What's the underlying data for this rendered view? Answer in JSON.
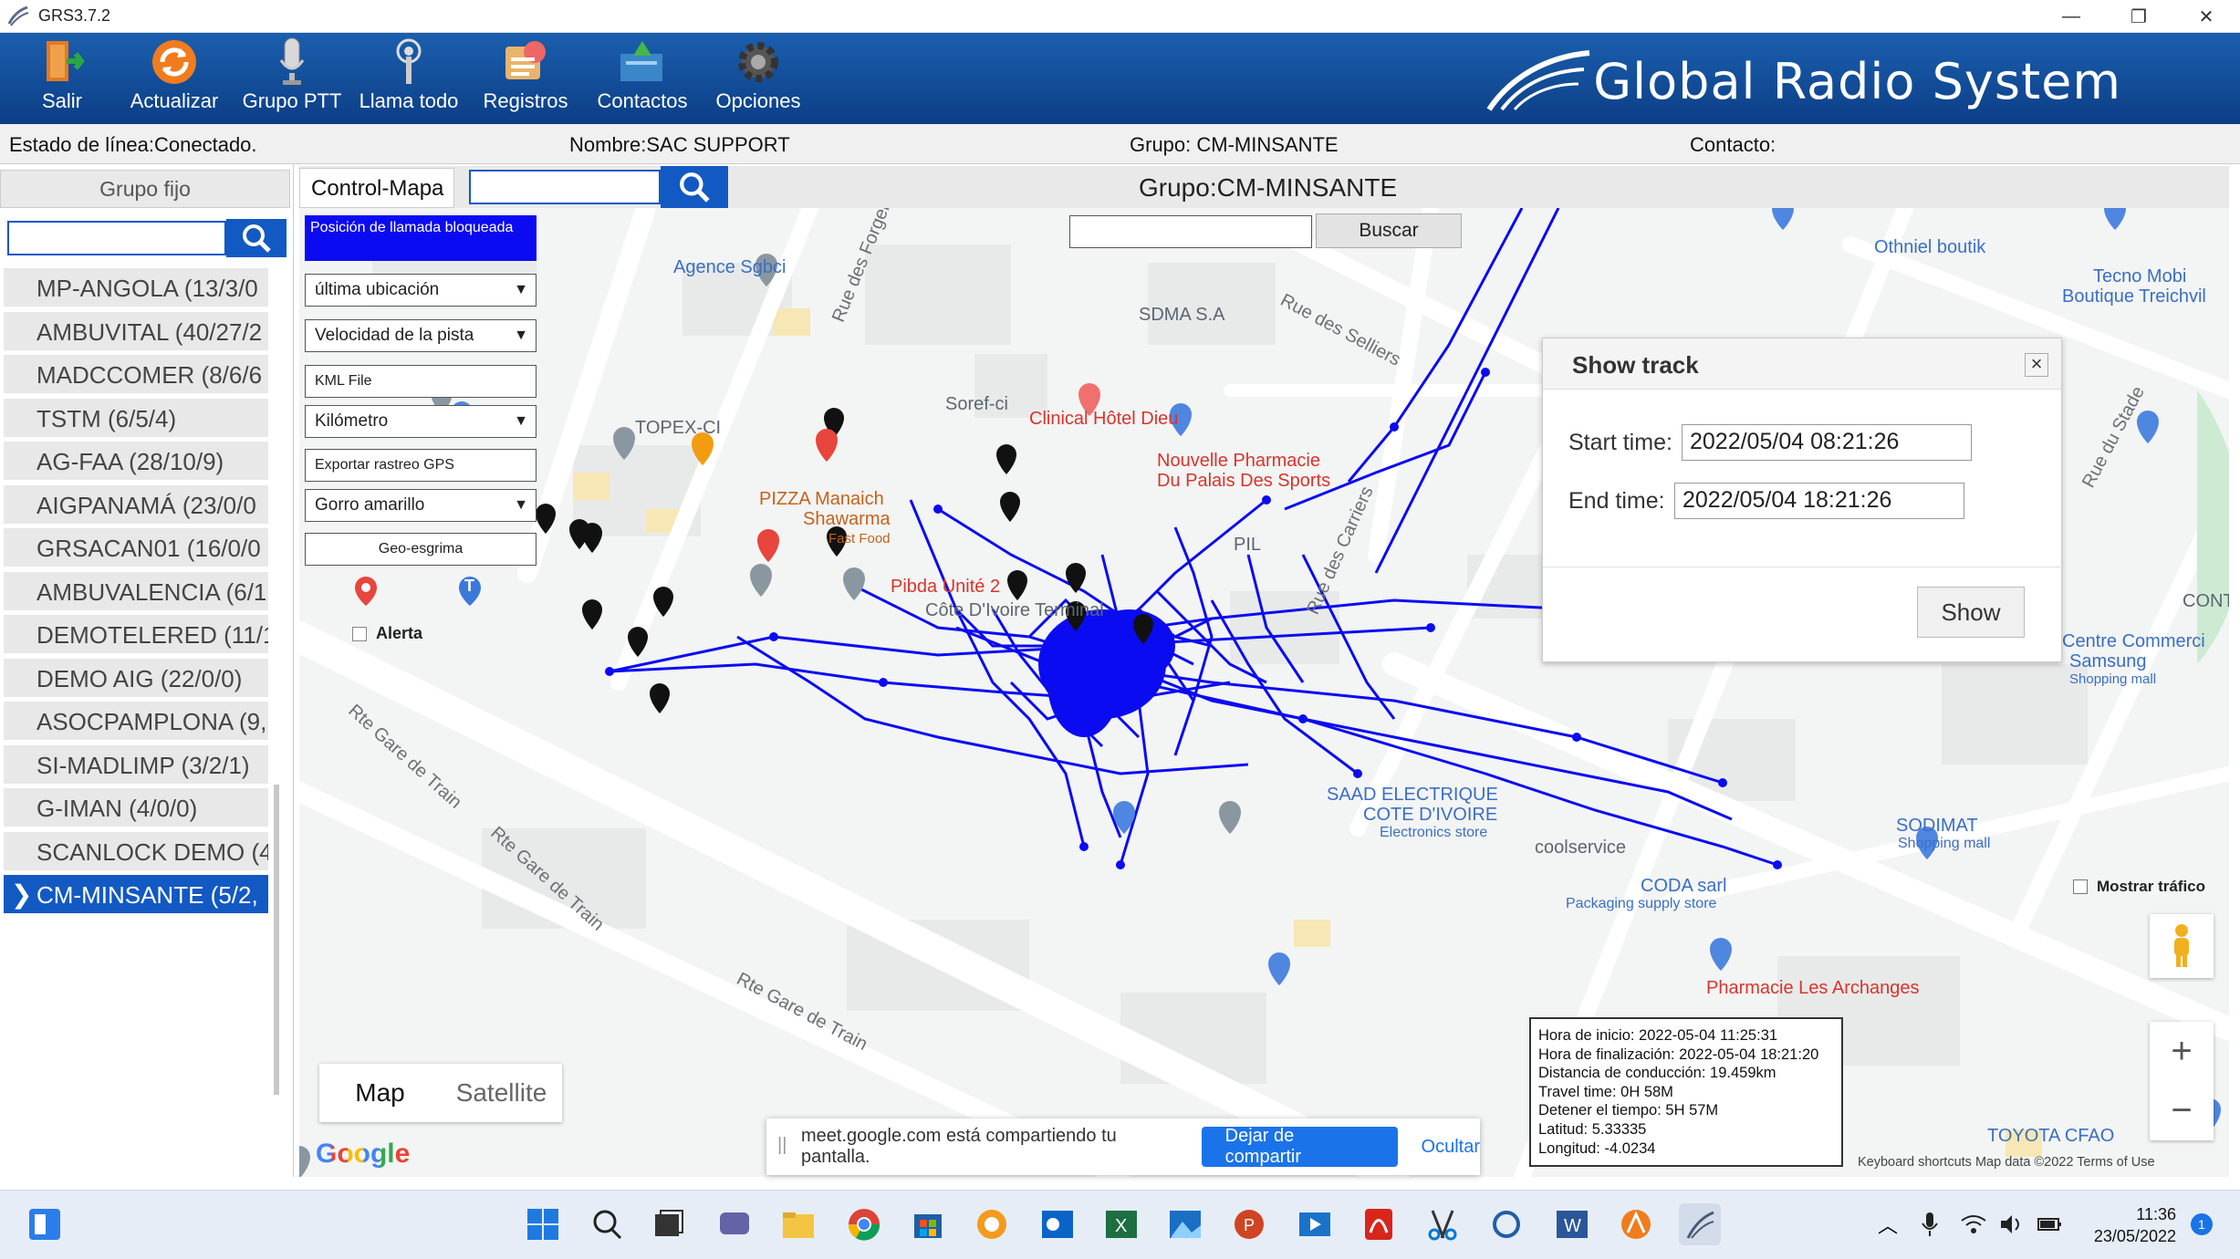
{
  "window": {
    "title": "GRS3.7.2"
  },
  "toolbar": {
    "items": [
      {
        "label": "Salir"
      },
      {
        "label": "Actualizar"
      },
      {
        "label": "Grupo PTT"
      },
      {
        "label": "Llama todo"
      },
      {
        "label": "Registros"
      },
      {
        "label": "Contactos"
      },
      {
        "label": "Opciones"
      }
    ],
    "brand": "Global Radio System"
  },
  "status": {
    "linea": "Estado de línea:Conectado.",
    "nombre": "Nombre:SAC SUPPORT",
    "grupo": "Grupo: CM-MINSANTE",
    "contacto": "Contacto:"
  },
  "left": {
    "header": "Grupo fijo",
    "groups": [
      "MP-ANGOLA (13/3/0",
      "AMBUVITAL (40/27/2",
      "MADCCOMER (8/6/6",
      "TSTM (6/5/4)",
      "AG-FAA (28/10/9)",
      "AIGPANAMÁ (23/0/0",
      "GRSACAN01 (16/0/0",
      "AMBUVALENCIA (6/1",
      "DEMOTELERED (11/1",
      "DEMO AIG (22/0/0)",
      "ASOCPAMPLONA (9,",
      "SI-MADLIMP (3/2/1)",
      "G-IMAN (4/0/0)",
      "SCANLOCK DEMO (4",
      "CM-MINSANTE (5/2,"
    ]
  },
  "mapheader": {
    "tab": "Control-Mapa",
    "title": "Grupo:CM-MINSANTE"
  },
  "control": {
    "posicion": "Posición de llamada bloqueada",
    "ultima": "última ubicación",
    "velocidad": "Velocidad de la pista",
    "kml": "KML File",
    "km": "Kilómetro",
    "exportar": "Exportar rastreo GPS",
    "gorro": "Gorro amarillo",
    "geo": "Geo-esgrima",
    "alerta": "Alerta",
    "t_marker": "T"
  },
  "search": {
    "buscar": "Buscar"
  },
  "showtrack": {
    "title": "Show track",
    "close": "×",
    "start_label": "Start time:",
    "start_value": "2022/05/04 08:21:26",
    "end_label": "End time:",
    "end_value": "2022/05/04 18:21:26",
    "button": "Show"
  },
  "info": {
    "lines": [
      "Hora de inicio: 2022-05-04 11:25:31",
      "Hora de finalización: 2022-05-04 18:21:20",
      "Distancia de conducción: 19.459km",
      "Travel time: 0H 58M",
      "Detener el tiempo: 5H 57M",
      "Latitud: 5.33335",
      "Longitud: -4.0234"
    ]
  },
  "map": {
    "pois": [
      {
        "t": "Agence Sgbci",
        "c": "blue"
      },
      {
        "t": "SDMA S.A",
        "c": "gray"
      },
      {
        "t": "TOPEX-CI",
        "c": "gray"
      },
      {
        "t": "Soref-ci",
        "c": "gray"
      },
      {
        "t": "Clinical Hôtel Dieu",
        "c": "red"
      },
      {
        "t": "Nouvelle Pharmacie",
        "c": "red"
      },
      {
        "t": "Du Palais Des Sports",
        "c": "red"
      },
      {
        "t": "PIZZA Manaich",
        "c": "orange"
      },
      {
        "t": "Shawarma",
        "c": "orange"
      },
      {
        "t": "Fast Food",
        "c": "orange"
      },
      {
        "t": "Pibda Unité 2",
        "c": "red"
      },
      {
        "t": "Côte D'Ivoire Terminal",
        "c": "gray"
      },
      {
        "t": "PIL",
        "c": "gray"
      },
      {
        "t": "Othniel boutik",
        "c": "blue"
      },
      {
        "t": "Tecno Mobi",
        "c": "blue"
      },
      {
        "t": "Boutique Treichvil",
        "c": "blue"
      },
      {
        "t": "Centre Commerci",
        "c": "blue"
      },
      {
        "t": "Samsung",
        "c": "blue"
      },
      {
        "t": "Shopping mall",
        "c": "blue"
      },
      {
        "t": "CONTR",
        "c": "gray"
      },
      {
        "t": "SAAD ELECTRIQUE",
        "c": "blue"
      },
      {
        "t": "COTE D'IVOIRE",
        "c": "blue"
      },
      {
        "t": "Electronics store",
        "c": "blue"
      },
      {
        "t": "coolservice",
        "c": "gray"
      },
      {
        "t": "CODA sarl",
        "c": "blue"
      },
      {
        "t": "Packaging supply store",
        "c": "blue"
      },
      {
        "t": "SODIMAT",
        "c": "blue"
      },
      {
        "t": "Shopping mall",
        "c": "blue"
      },
      {
        "t": "Pharmacie Les Archanges",
        "c": "red"
      },
      {
        "t": "TOYOTA CFAO",
        "c": "blue"
      }
    ],
    "roads": [
      "Rue des Forgerons",
      "Rue des Selliers",
      "Rue des Carriers",
      "Rue du Stade",
      "Rte Gare de Train",
      "Rte Gare de Train",
      "Rte Gare de Train"
    ],
    "maptype": [
      "Map",
      "Satellite"
    ],
    "mostrar": "Mostrar tráfico",
    "zoom_in": "+",
    "zoom_out": "−",
    "attribution": "Keyboard shortcuts    Map data ©2022    Terms of Use",
    "google": "Google"
  },
  "share": {
    "message": "meet.google.com está compartiendo tu pantalla.",
    "stop": "Dejar de compartir",
    "hide": "Ocultar"
  },
  "taskbar": {
    "time": "11:36",
    "date": "23/05/2022"
  }
}
